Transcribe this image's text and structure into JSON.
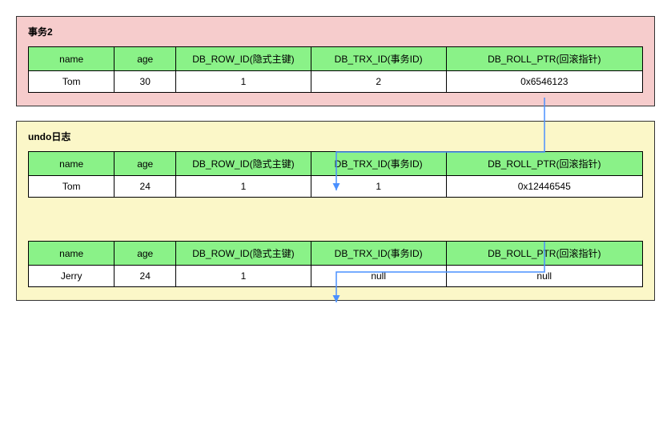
{
  "panels": {
    "tx2": {
      "title": "事务2"
    },
    "undo": {
      "title": "undo日志"
    }
  },
  "columns": {
    "name": "name",
    "age": "age",
    "row_id": "DB_ROW_ID(隐式主键)",
    "trx_id": "DB_TRX_ID(事务ID)",
    "roll_ptr": "DB_ROLL_PTR(回滚指针)"
  },
  "records": {
    "tx2_row": {
      "name": "Tom",
      "age": "30",
      "row_id": "1",
      "trx_id": "2",
      "roll_ptr": "0x6546123"
    },
    "undo_row1": {
      "name": "Tom",
      "age": "24",
      "row_id": "1",
      "trx_id": "1",
      "roll_ptr": "0x12446545"
    },
    "undo_row2": {
      "name": "Jerry",
      "age": "24",
      "row_id": "1",
      "trx_id": "null",
      "roll_ptr": "null"
    }
  },
  "chart_data": {
    "type": "table",
    "title": "MVCC version chain (DB_ROLL_PTR links)",
    "columns": [
      "name",
      "age",
      "DB_ROW_ID(隐式主键)",
      "DB_TRX_ID(事务ID)",
      "DB_ROLL_PTR(回滚指针)"
    ],
    "chain": [
      {
        "panel": "事务2",
        "name": "Tom",
        "age": 30,
        "db_row_id": 1,
        "db_trx_id": 2,
        "db_roll_ptr": "0x6546123"
      },
      {
        "panel": "undo日志",
        "name": "Tom",
        "age": 24,
        "db_row_id": 1,
        "db_trx_id": 1,
        "db_roll_ptr": "0x12446545"
      },
      {
        "panel": "undo日志",
        "name": "Jerry",
        "age": 24,
        "db_row_id": 1,
        "db_trx_id": null,
        "db_roll_ptr": null
      }
    ],
    "edges": [
      {
        "from": 0,
        "to": 1,
        "via": "DB_ROLL_PTR"
      },
      {
        "from": 1,
        "to": 2,
        "via": "DB_ROLL_PTR"
      }
    ]
  }
}
